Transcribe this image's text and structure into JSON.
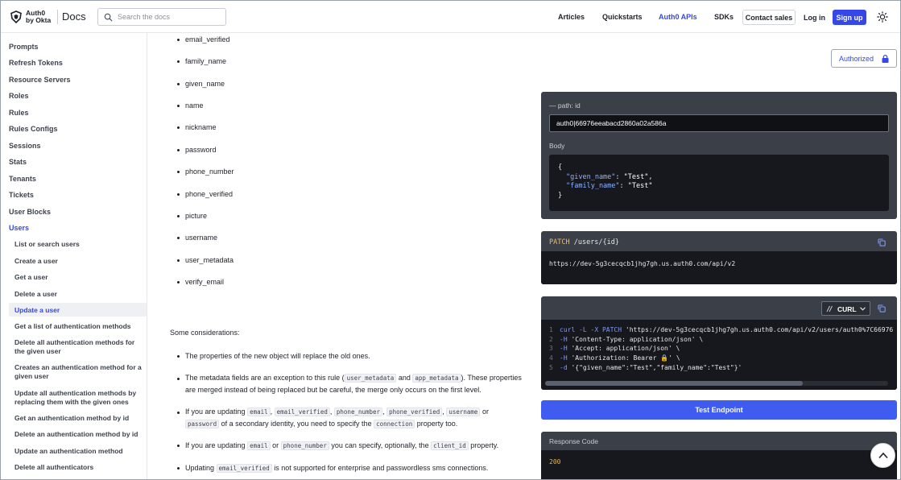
{
  "header": {
    "logo_line1": "Auth0",
    "logo_line2": "by Okta",
    "docs_label": "Docs",
    "search_placeholder": "Search the docs",
    "nav": [
      "Articles",
      "Quickstarts",
      "Auth0 APIs",
      "SDKs"
    ],
    "active_nav": "Auth0 APIs",
    "contact_label": "Contact sales",
    "login_label": "Log in",
    "signup_label": "Sign up"
  },
  "sidebar": {
    "items": [
      "Prompts",
      "Refresh Tokens",
      "Resource Servers",
      "Roles",
      "Rules",
      "Rules Configs",
      "Sessions",
      "Stats",
      "Tenants",
      "Tickets",
      "User Blocks",
      "Users"
    ],
    "active_item": "Users",
    "sub_items": [
      "List or search users",
      "Create a user",
      "Get a user",
      "Delete a user",
      "Update a user",
      "Get a list of authentication methods",
      "Delete all authentication methods for the given user",
      "Creates an authentication method for a given user",
      "Update all authentication methods by replacing them with the given ones",
      "Get an authentication method by id",
      "Delete an authentication method by id",
      "Update an authentication method",
      "Delete all authenticators"
    ],
    "active_sub_item": "Update a user"
  },
  "content": {
    "fields": [
      "email_verified",
      "family_name",
      "given_name",
      "name",
      "nickname",
      "password",
      "phone_number",
      "phone_verified",
      "picture",
      "username",
      "user_metadata",
      "verify_email"
    ],
    "considerations_title": "Some considerations:",
    "considerations": {
      "p1": "The properties of the new object will replace the old ones.",
      "p2_a": "The metadata fields are an exception to this rule (",
      "p2_c1": "user_metadata",
      "p2_and": " and ",
      "p2_c2": "app_metadata",
      "p2_b": "). These properties are merged instead of being replaced but be careful, the merge only occurs on the first level.",
      "p3_a": "If you are updating ",
      "p3_c1": "email",
      "p3_c2": "email_verified",
      "p3_c3": "phone_number",
      "p3_c4": "phone_verified",
      "p3_c5": "username",
      "p3_or": " or ",
      "p3_c6": "password",
      "p3_b": " of a secondary identity, you need to specify the ",
      "p3_c7": "connection",
      "p3_c": " property too.",
      "p4_a": "If you are updating ",
      "p4_c1": "email",
      "p4_or": " or ",
      "p4_c2": "phone_number",
      "p4_b": " you can specify, optionally, the ",
      "p4_c3": "client_id",
      "p4_c": " property.",
      "p5_a": "Updating ",
      "p5_c1": "email_verified",
      "p5_b": " is not supported for enterprise and passwordless sms connections."
    },
    "sep": ", "
  },
  "request": {
    "authorized_label": "Authorized",
    "path_label": "— path: id",
    "path_value": "auth0|66976eeabacd2860a02a586a",
    "body_label": "Body",
    "body_open": "{",
    "body_key1": "\"given_name\"",
    "body_val1": "\"Test\"",
    "body_key2": "\"family_name\"",
    "body_val2": "\"Test\"",
    "body_close": "}",
    "colon": ": ",
    "comma": ","
  },
  "endpoint": {
    "method": "PATCH",
    "path": "/users/{id}",
    "base_url": "https://dev-5g3cecqcb1jhg7gh.us.auth0.com/api/v2"
  },
  "curl": {
    "language": "CURL",
    "line_numbers": [
      "1",
      "2",
      "3",
      "4",
      "5"
    ],
    "l1_cmd": "curl -L -X PATCH ",
    "l1_str": "'https://dev-5g3cecqcb1jhg7gh.us.auth0.com/api/v2/users/auth0%7C66976",
    "l2_cmd": "-H ",
    "l2_str": "'Content-Type: application/json' \\",
    "l3_cmd": "-H ",
    "l3_str": "'Accept: application/json' \\",
    "l4_cmd": "-H ",
    "l4_str": "'Authorization: Bearer 🔒' \\",
    "l5_cmd": "-d ",
    "l5_str": "'{\"given_name\":\"Test\",\"family_name\":\"Test\"}'"
  },
  "actions": {
    "test_label": "Test Endpoint"
  },
  "response": {
    "label": "Response Code",
    "code": "200"
  },
  "colors": {
    "accent": "#3547e8",
    "button": "#3f5bf0",
    "panel": "#3b3f47",
    "code_bg": "#16181d",
    "response_code": "#e6b450"
  }
}
